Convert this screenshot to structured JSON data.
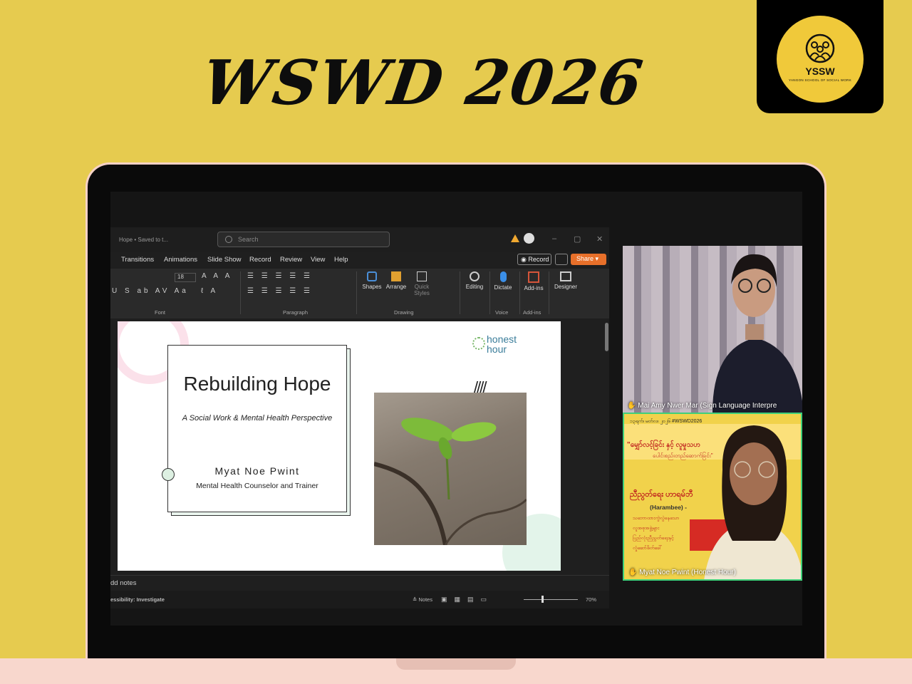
{
  "headline": "WSWD 2026",
  "logo": {
    "initials": "YSSW",
    "full_name": "YANGON SCHOOL OF SOCIAL WORK"
  },
  "ppt": {
    "doc_title": "Hope • Saved to t...",
    "search_placeholder": "Search",
    "menu": [
      "Transitions",
      "Animations",
      "Slide Show",
      "Record",
      "Review",
      "View",
      "Help"
    ],
    "record_label": "Record",
    "share_label": "Share",
    "ribbon": {
      "font_size": "18",
      "groups": [
        "Font",
        "Paragraph",
        "Drawing",
        "Voice",
        "Add-ins"
      ],
      "buttons": [
        "Shapes",
        "Arrange",
        "Quick Styles",
        "Editing",
        "Dictate",
        "Add-ins",
        "Designer"
      ]
    },
    "slide": {
      "title": "Rebuilding Hope",
      "subtitle": "A Social Work & Mental Health Perspective",
      "author": "Myat Noe Pwint",
      "role": "Mental Health Counselor and Trainer",
      "brand_line1": "honest",
      "brand_line2": "hour",
      "hatch": "////"
    },
    "notes_label": "dd notes",
    "status": {
      "accessibility": "essibility: Investigate",
      "notes": "Notes",
      "zoom": "70%"
    }
  },
  "participants": [
    {
      "name": "Mai Amy Nwer Mar (Sign Language Interpre"
    },
    {
      "name": "Myat Noe Pwint (Honest Hour)"
    }
  ],
  "poster": {
    "date": "၁၃ရက်၊ မတ်လ၊ ၂၀၂၆ #WSWD2026",
    "quote": "\"မျှော်လင့်ခြင်း နှင့် လူမှုသဟ",
    "line2": "ပေါင်းစည်းတည်ဆောက်ခြင်း\"",
    "heading": "ညီညွတ်ရေး ဟာရမ်ဘီ",
    "heading_sub": "(Harambee) -",
    "lines": [
      "သဘောထားကွဲလွဲနေသော",
      "လူအစုအဖွဲ့များ",
      "ပြည်လုံးညီညွတ်ရေးနှင့်",
      "လှုံဆော်ဖိတ်ခေါ်"
    ]
  },
  "colors": {
    "background": "#e6cb4f",
    "share": "#e8702a",
    "active_speaker": "#3fd07a"
  }
}
